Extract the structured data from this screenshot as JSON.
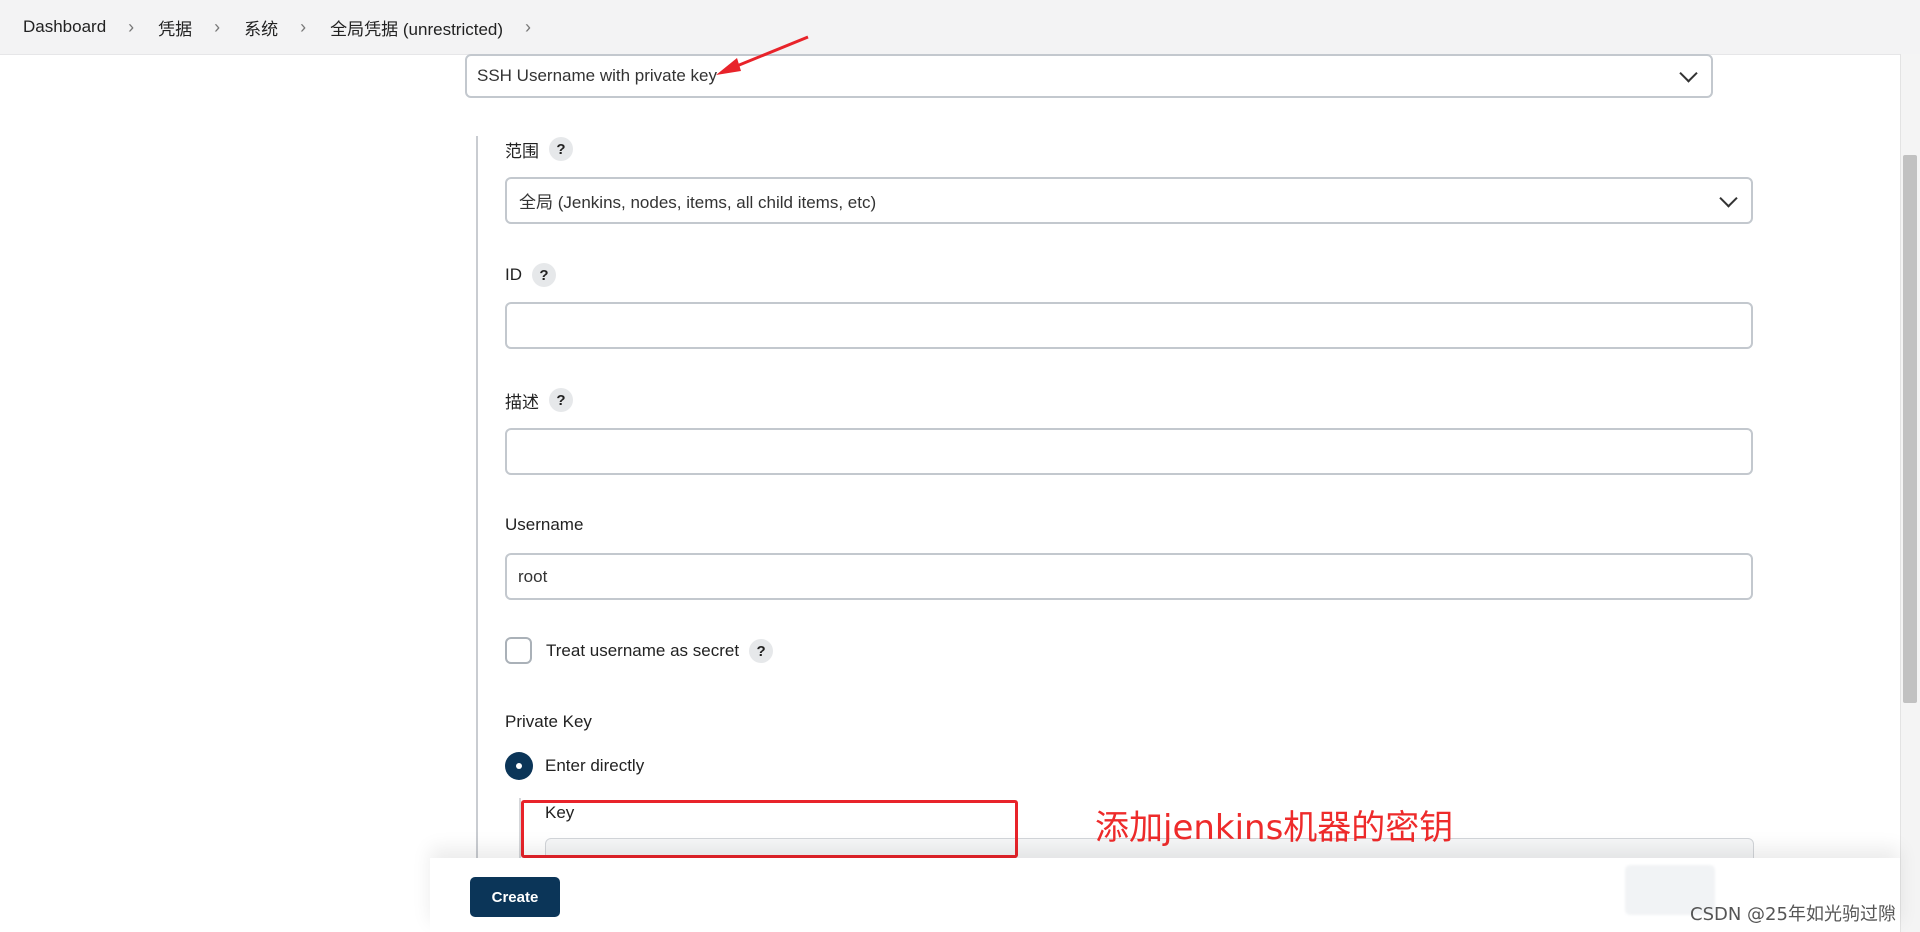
{
  "breadcrumb": {
    "items": [
      "Dashboard",
      "凭据",
      "系统",
      "全局凭据 (unrestricted)"
    ]
  },
  "kind_select": {
    "value": "SSH Username with private key"
  },
  "scope": {
    "label": "范围",
    "value": "全局 (Jenkins, nodes, items, all child items, etc)",
    "help": "?"
  },
  "id_field": {
    "label": "ID",
    "value": "",
    "help": "?"
  },
  "description_field": {
    "label": "描述",
    "value": "",
    "help": "?"
  },
  "username_field": {
    "label": "Username",
    "value": "root"
  },
  "treat_secret": {
    "label": "Treat username as secret",
    "checked": false,
    "help": "?"
  },
  "private_key": {
    "label": "Private Key",
    "option_label": "Enter directly",
    "selected": true,
    "key_label": "Key"
  },
  "annotation": {
    "text": "添加jenkins机器的密钥",
    "color": "#e8232a"
  },
  "actions": {
    "create_label": "Create"
  },
  "watermark": "CSDN @25年如光驹过隙",
  "colors": {
    "primary": "#0b3558",
    "annotation": "#e8232a"
  }
}
